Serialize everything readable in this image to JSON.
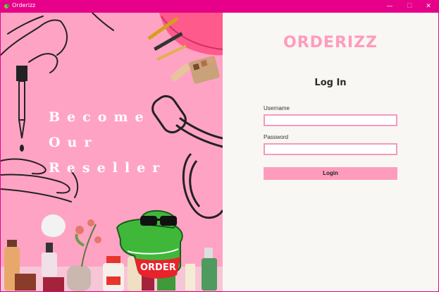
{
  "window": {
    "title": "Orderizz",
    "controls": {
      "minimize": "—",
      "maximize": "☐",
      "close": "✕"
    },
    "colors": {
      "titlebar": "#e6008a"
    }
  },
  "hero": {
    "headline": [
      "Become",
      "Our",
      "Reseller"
    ],
    "badge_text": "ORDER",
    "colors": {
      "background": "#ffa3c4"
    }
  },
  "login": {
    "logo": "ORDERIZZ",
    "heading": "Log In",
    "username_label": "Username",
    "username_value": "",
    "password_label": "Password",
    "password_value": "",
    "button_label": "Login",
    "colors": {
      "accent": "#ff9cbd",
      "panel": "#f9f7f4"
    }
  }
}
